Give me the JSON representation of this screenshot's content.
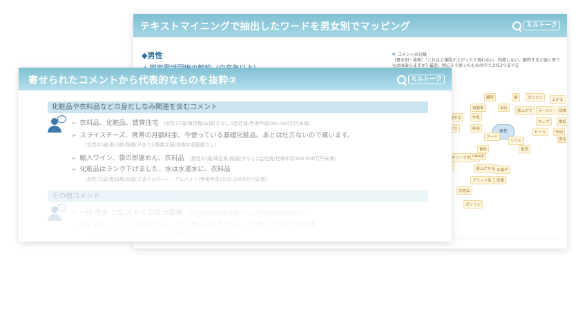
{
  "back_slide": {
    "title": "テキストマイニングで抽出したワードを男女別でマッピング",
    "logo_text": "ミルトーク",
    "section": "◆男性",
    "item": "✓ 固定電話回線の解約（中高年以上）",
    "note_label": "コメントの分類",
    "note_text": "［男女別・抜粋］「これ以上値段が上がったら買わない、利用しない、解約すると強く思うものはありますか？最近、特にそう思ったものの中で上位3つまでを",
    "hub": "男性",
    "nodes": [
      "購買",
      "鍵",
      "ガソリン",
      "上がる",
      "自動車",
      "会社",
      "値上がり",
      "ラーメン",
      "回線",
      "利用する",
      "牛乳",
      "カップ",
      "電話",
      "あがり",
      "料金",
      "ビール",
      "作用",
      "固定",
      "フード",
      "ソフト",
      "食料",
      "家庭",
      "オリーブオイル",
      "PRIME",
      "パン",
      "値上げする",
      "お菓子",
      "プランド品",
      "医薬",
      "化粧品",
      "ガソリン"
    ]
  },
  "front_slide": {
    "title": "寄せられたコメントから代表的なものを抜粋②",
    "logo_text": "ミルトーク",
    "category1": "化粧品や衣料品などの身だしなみ関連を含むコメント",
    "comments1": [
      {
        "text": "衣料品、化粧品、賃貸住宅",
        "meta": "（女性37歳/東京都/未婚(子なし)/会社員/世帯年収200-400万円未満）"
      },
      {
        "text": "スライスチーズ、携帯の月額料金、今使っている基礎化粧品。あとは仕方ないので買います。",
        "meta": ""
      },
      {
        "text": "輸入ワイン、袋の即席めん、衣料品",
        "meta": "（男性57歳/埼玉県/既婚(子なし)/会社員/世帯年収400-600万円未満）"
      },
      {
        "text": "化粧品はランク下げました、水は水道水に、衣料品",
        "meta": ""
      }
    ],
    "meta_lines1": [
      "（女性41歳/香川県/既婚(子あり)/専業主婦/世帯年収登録なし）",
      "（女性71歳/愛知県/未婚(子あり)/パート・アルバイト/世帯年収1500-2000万円未満）"
    ],
    "category2": "その他コメント",
    "comments2": [
      {
        "text": "一位:学会 二位:スタバ 三位:自販機",
        "meta": "（女性39歳/大阪府/未婚(子なし)/学生/世帯年収登録なし）"
      },
      {
        "text": "ディズニーリゾートのチケット、コンサートのチケット、スポーツクラブの会費",
        "meta": ""
      }
    ],
    "meta_lines2": [
      "（女性46歳/東京都/既婚(子なし)/会社員/世帯年収1000-1200万円未満）"
    ],
    "bubble_icon": "speech-bubble-icon",
    "person_icon": "person-icon"
  },
  "colors": {
    "header": "#7fc0d3",
    "category_bg": "#c9e5ef",
    "accent": "#3d79ad"
  }
}
